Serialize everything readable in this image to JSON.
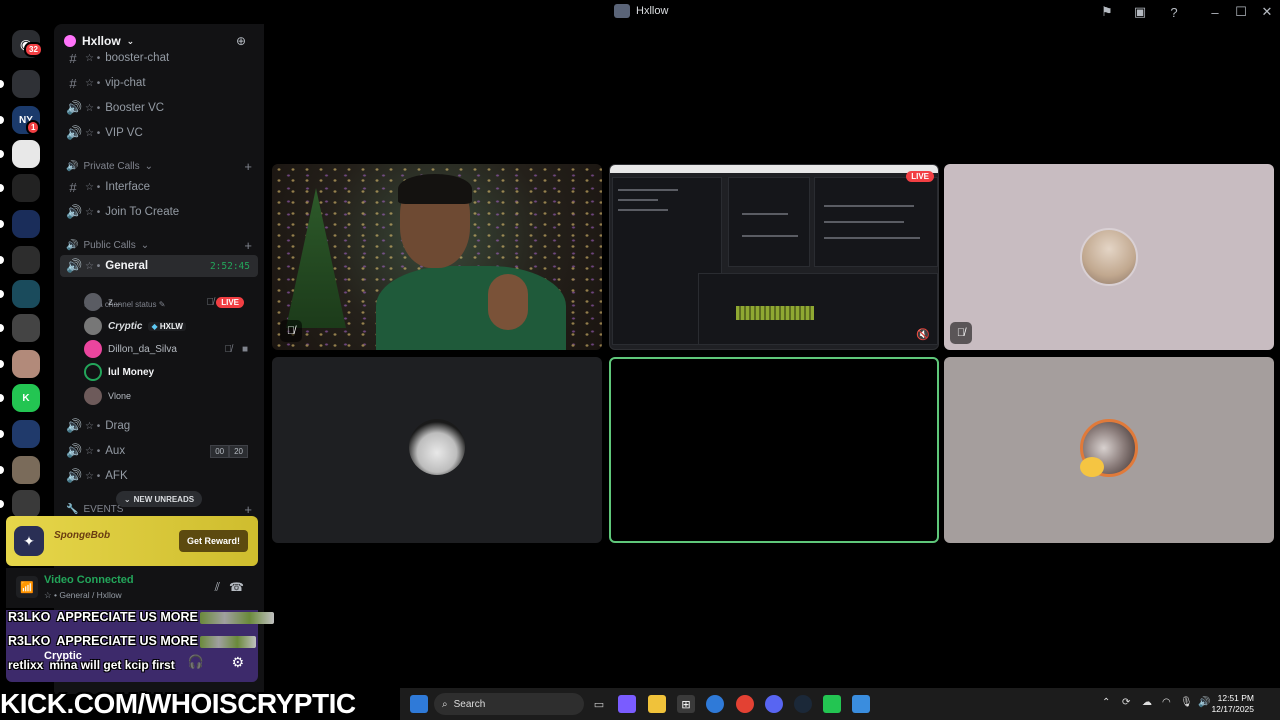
{
  "window": {
    "title": "Hxllow"
  },
  "guilds": {
    "home_badge": "32",
    "items": [
      {
        "name": "server-1",
        "color": "#2f3136",
        "label": ""
      },
      {
        "name": "server-ny",
        "color": "#1b3a6b",
        "label": "NY",
        "badge": "1"
      },
      {
        "name": "server-money",
        "color": "#e8e8e8",
        "label": ""
      },
      {
        "name": "server-4",
        "color": "#222",
        "label": ""
      },
      {
        "name": "server-5",
        "color": "#1a2d5a",
        "label": ""
      },
      {
        "name": "server-6",
        "color": "#2d2d2d",
        "label": ""
      },
      {
        "name": "server-7",
        "color": "#1a4b5c",
        "label": ""
      },
      {
        "name": "server-8",
        "color": "#444",
        "label": ""
      },
      {
        "name": "server-9",
        "color": "#b28a7a",
        "label": ""
      },
      {
        "name": "server-kick",
        "color": "#23c552",
        "label": "K"
      },
      {
        "name": "server-11",
        "color": "#203a6b",
        "label": ""
      },
      {
        "name": "server-12",
        "color": "#7a6b5a",
        "label": ""
      },
      {
        "name": "server-13",
        "color": "#3a3a3a",
        "label": ""
      }
    ]
  },
  "server": {
    "name": "Hxllow"
  },
  "channels": {
    "booster_chat": "booster-chat",
    "vip_chat": "vip-chat",
    "booster_vc": "Booster VC",
    "vip_vc": "VIP VC",
    "cat_private": "Private Calls",
    "interface": "Interface",
    "join_to_create": "Join To Create",
    "cat_public": "Public Calls",
    "general": "General",
    "general_timer": "2:52:45",
    "status_placeholder": "Set a channel status",
    "drag": "Drag",
    "aux": "Aux",
    "aux_count": "00",
    "aux_limit": "20",
    "afk": "AFK",
    "cat_events": "EVENTS",
    "new_unreads": "NEW UNREADS"
  },
  "voice_users": [
    {
      "name": "z...",
      "live": "LIVE"
    },
    {
      "name": "Cryptic",
      "clan": "HXLW"
    },
    {
      "name": "Dillon_da_Silva"
    },
    {
      "name": "lul Money"
    },
    {
      "name": "Vlone"
    }
  ],
  "promo": {
    "logo": "SpongeBob",
    "button": "Get Reward!"
  },
  "voice_panel": {
    "status": "Video Connected",
    "location": "General / Hxllow"
  },
  "user_panel": {
    "name": "Cryptic"
  },
  "overlay_chat": [
    {
      "who": "R3LKO",
      "msg": "APPRECIATE US MORE"
    },
    {
      "who": "R3LKO",
      "msg": "APPRECIATE US MORE"
    },
    {
      "who": "retlixx",
      "msg": "mina will get kcip first"
    }
  ],
  "stream": {
    "live_label": "LIVE"
  },
  "banner": {
    "text": "KICK.COM/WHOISCRYPTIC"
  },
  "taskbar": {
    "search_placeholder": "Search",
    "time": "12:51 PM",
    "date": "12/17/2025"
  },
  "colors": {
    "accent_green": "#23a55a",
    "live_red": "#f23f43",
    "promo_yellow": "#e6d64a"
  }
}
